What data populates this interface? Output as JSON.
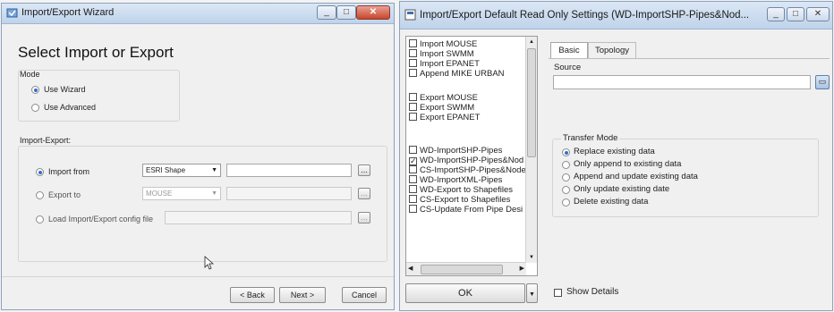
{
  "wizard": {
    "title": "Import/Export Wizard",
    "heading": "Select Import or Export",
    "mode_label": "Mode",
    "use_wizard": "Use Wizard",
    "use_advanced": "Use Advanced",
    "import_export_label": "Import-Export:",
    "import_from": "Import from",
    "import_from_type": "ESRI Shape",
    "export_to": "Export to",
    "export_to_type": "MOUSE",
    "load_config": "Load Import/Export config file",
    "browse": "...",
    "back": "< Back",
    "next": "Next >",
    "cancel": "Cancel"
  },
  "settings": {
    "title": "Import/Export Default Read Only Settings (WD-ImportSHP-Pipes&Nod...",
    "list_items": [
      {
        "label": "Import MOUSE",
        "checked": false
      },
      {
        "label": "Import SWMM",
        "checked": false
      },
      {
        "label": "Import EPANET",
        "checked": false
      },
      {
        "label": "Append MIKE URBAN",
        "checked": false
      },
      {
        "label": "Export MOUSE",
        "checked": false
      },
      {
        "label": "Export SWMM",
        "checked": false
      },
      {
        "label": "Export EPANET",
        "checked": false
      },
      {
        "label": "WD-ImportSHP-Pipes",
        "checked": false
      },
      {
        "label": "WD-ImportSHP-Pipes&Nod",
        "checked": true
      },
      {
        "label": "CS-ImportSHP-Pipes&Node",
        "checked": false
      },
      {
        "label": "WD-ImportXML-Pipes",
        "checked": false
      },
      {
        "label": "WD-Export to Shapefiles",
        "checked": false
      },
      {
        "label": "CS-Export to Shapefiles",
        "checked": false
      },
      {
        "label": "CS-Update From Pipe Desi",
        "checked": false
      }
    ],
    "tab_basic": "Basic",
    "tab_topology": "Topology",
    "source_label": "Source",
    "transfer_mode_label": "Transfer Mode",
    "transfer_options": [
      {
        "label": "Replace existing data",
        "selected": true
      },
      {
        "label": "Only append to existing data",
        "selected": false
      },
      {
        "label": "Append and update existing data",
        "selected": false
      },
      {
        "label": "Only update existing date",
        "selected": false
      },
      {
        "label": "Delete existing data",
        "selected": false
      }
    ],
    "ok": "OK",
    "show_details": "Show Details",
    "browse": "..."
  }
}
